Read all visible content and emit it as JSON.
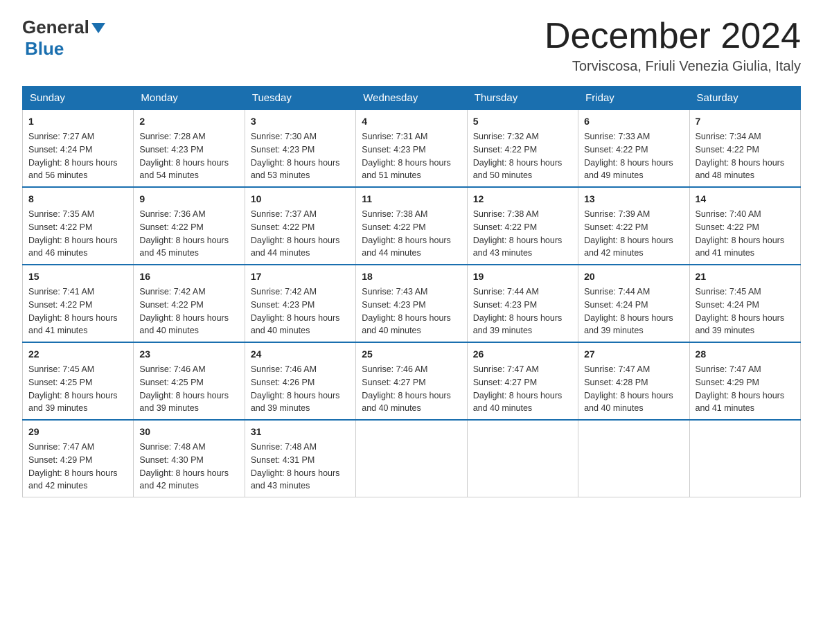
{
  "header": {
    "logo_general": "General",
    "logo_blue": "Blue",
    "month_title": "December 2024",
    "location": "Torviscosa, Friuli Venezia Giulia, Italy"
  },
  "weekdays": [
    "Sunday",
    "Monday",
    "Tuesday",
    "Wednesday",
    "Thursday",
    "Friday",
    "Saturday"
  ],
  "weeks": [
    [
      {
        "day": "1",
        "sunrise": "7:27 AM",
        "sunset": "4:24 PM",
        "daylight": "8 hours and 56 minutes."
      },
      {
        "day": "2",
        "sunrise": "7:28 AM",
        "sunset": "4:23 PM",
        "daylight": "8 hours and 54 minutes."
      },
      {
        "day": "3",
        "sunrise": "7:30 AM",
        "sunset": "4:23 PM",
        "daylight": "8 hours and 53 minutes."
      },
      {
        "day": "4",
        "sunrise": "7:31 AM",
        "sunset": "4:23 PM",
        "daylight": "8 hours and 51 minutes."
      },
      {
        "day": "5",
        "sunrise": "7:32 AM",
        "sunset": "4:22 PM",
        "daylight": "8 hours and 50 minutes."
      },
      {
        "day": "6",
        "sunrise": "7:33 AM",
        "sunset": "4:22 PM",
        "daylight": "8 hours and 49 minutes."
      },
      {
        "day": "7",
        "sunrise": "7:34 AM",
        "sunset": "4:22 PM",
        "daylight": "8 hours and 48 minutes."
      }
    ],
    [
      {
        "day": "8",
        "sunrise": "7:35 AM",
        "sunset": "4:22 PM",
        "daylight": "8 hours and 46 minutes."
      },
      {
        "day": "9",
        "sunrise": "7:36 AM",
        "sunset": "4:22 PM",
        "daylight": "8 hours and 45 minutes."
      },
      {
        "day": "10",
        "sunrise": "7:37 AM",
        "sunset": "4:22 PM",
        "daylight": "8 hours and 44 minutes."
      },
      {
        "day": "11",
        "sunrise": "7:38 AM",
        "sunset": "4:22 PM",
        "daylight": "8 hours and 44 minutes."
      },
      {
        "day": "12",
        "sunrise": "7:38 AM",
        "sunset": "4:22 PM",
        "daylight": "8 hours and 43 minutes."
      },
      {
        "day": "13",
        "sunrise": "7:39 AM",
        "sunset": "4:22 PM",
        "daylight": "8 hours and 42 minutes."
      },
      {
        "day": "14",
        "sunrise": "7:40 AM",
        "sunset": "4:22 PM",
        "daylight": "8 hours and 41 minutes."
      }
    ],
    [
      {
        "day": "15",
        "sunrise": "7:41 AM",
        "sunset": "4:22 PM",
        "daylight": "8 hours and 41 minutes."
      },
      {
        "day": "16",
        "sunrise": "7:42 AM",
        "sunset": "4:22 PM",
        "daylight": "8 hours and 40 minutes."
      },
      {
        "day": "17",
        "sunrise": "7:42 AM",
        "sunset": "4:23 PM",
        "daylight": "8 hours and 40 minutes."
      },
      {
        "day": "18",
        "sunrise": "7:43 AM",
        "sunset": "4:23 PM",
        "daylight": "8 hours and 40 minutes."
      },
      {
        "day": "19",
        "sunrise": "7:44 AM",
        "sunset": "4:23 PM",
        "daylight": "8 hours and 39 minutes."
      },
      {
        "day": "20",
        "sunrise": "7:44 AM",
        "sunset": "4:24 PM",
        "daylight": "8 hours and 39 minutes."
      },
      {
        "day": "21",
        "sunrise": "7:45 AM",
        "sunset": "4:24 PM",
        "daylight": "8 hours and 39 minutes."
      }
    ],
    [
      {
        "day": "22",
        "sunrise": "7:45 AM",
        "sunset": "4:25 PM",
        "daylight": "8 hours and 39 minutes."
      },
      {
        "day": "23",
        "sunrise": "7:46 AM",
        "sunset": "4:25 PM",
        "daylight": "8 hours and 39 minutes."
      },
      {
        "day": "24",
        "sunrise": "7:46 AM",
        "sunset": "4:26 PM",
        "daylight": "8 hours and 39 minutes."
      },
      {
        "day": "25",
        "sunrise": "7:46 AM",
        "sunset": "4:27 PM",
        "daylight": "8 hours and 40 minutes."
      },
      {
        "day": "26",
        "sunrise": "7:47 AM",
        "sunset": "4:27 PM",
        "daylight": "8 hours and 40 minutes."
      },
      {
        "day": "27",
        "sunrise": "7:47 AM",
        "sunset": "4:28 PM",
        "daylight": "8 hours and 40 minutes."
      },
      {
        "day": "28",
        "sunrise": "7:47 AM",
        "sunset": "4:29 PM",
        "daylight": "8 hours and 41 minutes."
      }
    ],
    [
      {
        "day": "29",
        "sunrise": "7:47 AM",
        "sunset": "4:29 PM",
        "daylight": "8 hours and 42 minutes."
      },
      {
        "day": "30",
        "sunrise": "7:48 AM",
        "sunset": "4:30 PM",
        "daylight": "8 hours and 42 minutes."
      },
      {
        "day": "31",
        "sunrise": "7:48 AM",
        "sunset": "4:31 PM",
        "daylight": "8 hours and 43 minutes."
      },
      null,
      null,
      null,
      null
    ]
  ],
  "labels": {
    "sunrise": "Sunrise:",
    "sunset": "Sunset:",
    "daylight": "Daylight:"
  }
}
